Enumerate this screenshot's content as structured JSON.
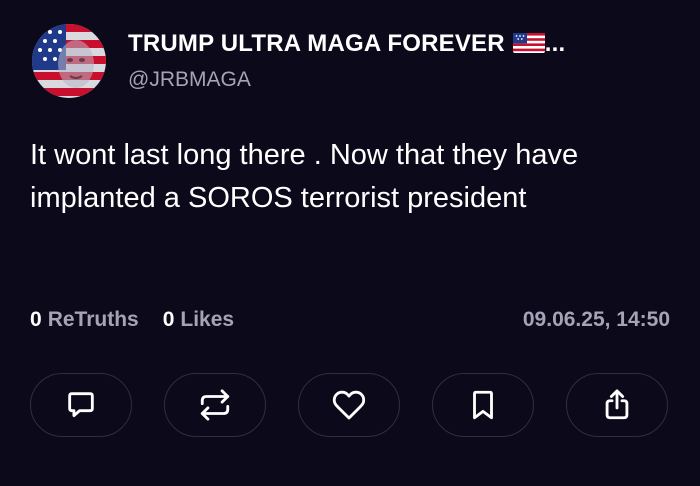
{
  "author": {
    "display_name": "TRUMP ULTRA MAGA FOREVER",
    "ellipsis": "...",
    "handle": "@JRBMAGA",
    "avatar_icon": "flag-face-avatar",
    "flag_icon": "us-flag-icon"
  },
  "post": {
    "text": "It wont last long there . Now that they have implanted a SOROS terrorist president"
  },
  "stats": {
    "retruths_count": "0",
    "retruths_label": "ReTruths",
    "likes_count": "0",
    "likes_label": "Likes",
    "timestamp": "09.06.25, 14:50"
  },
  "actions": [
    {
      "name": "reply",
      "icon": "comment-icon"
    },
    {
      "name": "retruth",
      "icon": "repost-icon"
    },
    {
      "name": "like",
      "icon": "heart-icon"
    },
    {
      "name": "bookmark",
      "icon": "bookmark-icon"
    },
    {
      "name": "share",
      "icon": "share-icon"
    }
  ],
  "colors": {
    "background": "#0c0a1a",
    "text": "#ffffff",
    "muted": "#a6a3b6",
    "button_border": "#2f2c44"
  }
}
